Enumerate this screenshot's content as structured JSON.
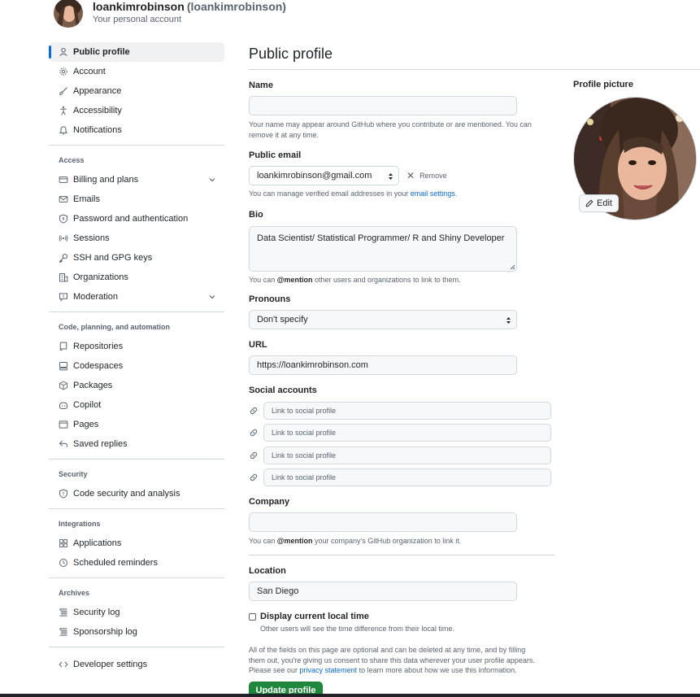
{
  "user": {
    "name": "loankimrobinson",
    "login": "(loankimrobinson)",
    "subtitle": "Your personal account"
  },
  "sidebar": {
    "top": [
      {
        "label": "Public profile",
        "icon": "person-icon",
        "active": true
      },
      {
        "label": "Account",
        "icon": "gear-icon"
      },
      {
        "label": "Appearance",
        "icon": "paintbrush-icon"
      },
      {
        "label": "Accessibility",
        "icon": "accessibility-icon"
      },
      {
        "label": "Notifications",
        "icon": "bell-icon"
      }
    ],
    "groups": [
      {
        "title": "Access",
        "items": [
          {
            "label": "Billing and plans",
            "icon": "credit-card-icon",
            "expandable": true
          },
          {
            "label": "Emails",
            "icon": "mail-icon"
          },
          {
            "label": "Password and authentication",
            "icon": "shield-lock-icon"
          },
          {
            "label": "Sessions",
            "icon": "broadcast-icon"
          },
          {
            "label": "SSH and GPG keys",
            "icon": "key-icon"
          },
          {
            "label": "Organizations",
            "icon": "organization-icon"
          },
          {
            "label": "Moderation",
            "icon": "report-icon",
            "expandable": true
          }
        ]
      },
      {
        "title": "Code, planning, and automation",
        "items": [
          {
            "label": "Repositories",
            "icon": "repo-icon"
          },
          {
            "label": "Codespaces",
            "icon": "codespaces-icon"
          },
          {
            "label": "Packages",
            "icon": "package-icon"
          },
          {
            "label": "Copilot",
            "icon": "copilot-icon"
          },
          {
            "label": "Pages",
            "icon": "browser-icon"
          },
          {
            "label": "Saved replies",
            "icon": "reply-icon"
          }
        ]
      },
      {
        "title": "Security",
        "items": [
          {
            "label": "Code security and analysis",
            "icon": "codescan-icon"
          }
        ]
      },
      {
        "title": "Integrations",
        "items": [
          {
            "label": "Applications",
            "icon": "apps-icon"
          },
          {
            "label": "Scheduled reminders",
            "icon": "clock-icon"
          }
        ]
      },
      {
        "title": "Archives",
        "items": [
          {
            "label": "Security log",
            "icon": "log-icon"
          },
          {
            "label": "Sponsorship log",
            "icon": "log-icon"
          }
        ]
      }
    ],
    "developer": {
      "label": "Developer settings",
      "icon": "code-icon"
    }
  },
  "main": {
    "title": "Public profile",
    "name": {
      "label": "Name",
      "value": "",
      "note": "Your name may appear around GitHub where you contribute or are mentioned. You can remove it at any time."
    },
    "email": {
      "label": "Public email",
      "value": "loankimrobinson@gmail.com",
      "remove": "Remove",
      "note_prefix": "You can manage verified email addresses in your ",
      "note_link": "email settings",
      "note_suffix": "."
    },
    "bio": {
      "label": "Bio",
      "value": "Data Scientist/ Statistical Programmer/ R and Shiny Developer",
      "note_prefix": "You can ",
      "note_mention": "@mention",
      "note_suffix": " other users and organizations to link to them."
    },
    "pronouns": {
      "label": "Pronouns",
      "value": "Don't specify"
    },
    "url": {
      "label": "URL",
      "value": "https://loankimrobinson.com"
    },
    "social": {
      "label": "Social accounts",
      "placeholder": "Link to social profile",
      "count": 4
    },
    "company": {
      "label": "Company",
      "value": "",
      "note_prefix": "You can ",
      "note_mention": "@mention",
      "note_suffix": " your company's GitHub organization to link it."
    },
    "location": {
      "label": "Location",
      "value": "San Diego"
    },
    "local_time": {
      "label": "Display current local time",
      "note": "Other users will see the time difference from their local time.",
      "checked": false
    },
    "footer": {
      "line1": "All of the fields on this page are optional and can be deleted at any time, and by filling",
      "line2": "them out, you're giving us consent to share this data wherever your user profile appears.",
      "line3_prefix": "Please see our ",
      "line3_link": "privacy statement",
      "line3_suffix": " to learn more about how we use this information."
    },
    "update_button": "Update profile",
    "profile_picture": {
      "label": "Profile picture",
      "edit": "Edit"
    }
  },
  "colors": {
    "accent": "#0969da",
    "primary_button": "#1f883d"
  }
}
